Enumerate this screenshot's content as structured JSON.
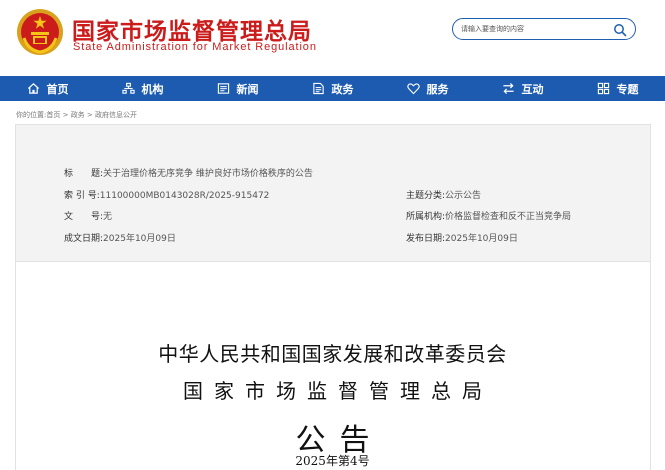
{
  "header": {
    "title": "国家市场监督管理总局",
    "subtitle": "State Administration for Market Regulation",
    "search_placeholder": "请输入要查询的内容"
  },
  "nav": {
    "items": [
      {
        "label": "首页",
        "icon": "home-icon"
      },
      {
        "label": "机构",
        "icon": "org-icon"
      },
      {
        "label": "新闻",
        "icon": "news-icon"
      },
      {
        "label": "政务",
        "icon": "affairs-icon"
      },
      {
        "label": "服务",
        "icon": "service-icon"
      },
      {
        "label": "互动",
        "icon": "interact-icon"
      },
      {
        "label": "专题",
        "icon": "topic-icon"
      }
    ]
  },
  "breadcrumb": {
    "prefix": "你的位置:",
    "items": [
      "首页",
      "政务",
      "政府信息公开"
    ],
    "separator": " > "
  },
  "info": {
    "title_label": "标　　题:",
    "title_value": "关于治理价格无序竞争 维护良好市场价格秩序的公告",
    "index_label": "索 引 号:",
    "index_value": "11100000MB0143028R/2025-915472",
    "topic_label": "主题分类:",
    "topic_value": "公示公告",
    "docno_label": "文　　号:",
    "docno_value": "无",
    "org_label": "所属机构:",
    "org_value": "价格监督检查和反不正当竞争局",
    "created_label": "成文日期:",
    "created_value": "2025年10月09日",
    "published_label": "发布日期:",
    "published_value": "2025年10月09日"
  },
  "document": {
    "issuer1": "中华人民共和国国家发展和改革委员会",
    "issuer2": "国家市场监督管理总局",
    "type": "公告",
    "number": "2025年第4号"
  },
  "colors": {
    "brand_red": "#cc1b1b",
    "nav_blue": "#1c5bb0"
  }
}
